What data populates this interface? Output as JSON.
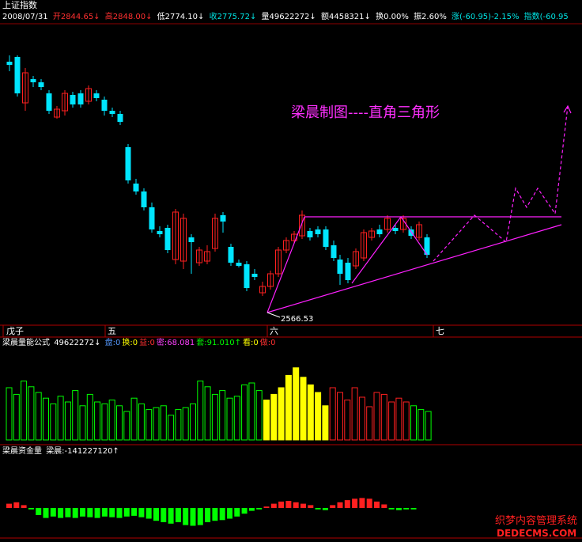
{
  "window": {
    "title": "上证指数"
  },
  "info_bar": {
    "date": "2008/07/31",
    "open": "开2844.65↓",
    "high": "高2848.00↓",
    "low": "低2774.10↓",
    "close": "收2775.72↓",
    "volume": "量49622272↓",
    "amount": "额4458321↓",
    "turnover": "换0.00%",
    "amplitude": "振2.60%",
    "change": "涨(-60.95)-2.15%",
    "index": "指数(-60.95"
  },
  "price_chart": {
    "annotation_title": "梁晨制图----直角三角形",
    "low_label": "2566.53",
    "colors": {
      "up": "#ff2020",
      "down": "#00e5ff",
      "drawing": "#ff20ff"
    }
  },
  "time_axis": {
    "labels": [
      "戊子",
      "五",
      "六",
      "七"
    ]
  },
  "volume_panel": {
    "formula": "梁晨量能公式",
    "value": "49622272↓",
    "items": [
      {
        "text": "盘:0",
        "color": "#5599ff"
      },
      {
        "text": "换:0",
        "color": "#ffff00"
      },
      {
        "text": "益:0",
        "color": "#ff3030"
      },
      {
        "text": "密:68.081",
        "color": "#ff40ff"
      },
      {
        "text": "套:91.010↑",
        "color": "#00ff00"
      },
      {
        "text": "看:0",
        "color": "#ffff00"
      },
      {
        "text": "做:0",
        "color": "#ff3030"
      }
    ],
    "values": [
      55,
      48,
      62,
      56,
      50,
      44,
      38,
      46,
      40,
      52,
      36,
      48,
      40,
      38,
      42,
      36,
      30,
      44,
      38,
      32,
      34,
      36,
      26,
      32,
      34,
      38,
      62,
      56,
      48,
      52,
      44,
      46,
      58,
      60,
      52,
      42,
      48,
      55,
      68,
      76,
      66,
      58,
      50,
      36,
      55,
      50,
      42,
      55,
      45,
      35,
      50,
      48,
      40,
      44,
      40,
      36,
      32,
      30
    ],
    "colors": [
      "green",
      "green",
      "green",
      "green",
      "green",
      "green",
      "green",
      "green",
      "green",
      "green",
      "green",
      "green",
      "green",
      "green",
      "green",
      "green",
      "green",
      "green",
      "green",
      "green",
      "green",
      "green",
      "green",
      "green",
      "green",
      "green",
      "green",
      "green",
      "green",
      "green",
      "green",
      "green",
      "green",
      "green",
      "green",
      "yellow",
      "yellow",
      "yellow",
      "yellow",
      "yellow",
      "yellow",
      "yellow",
      "yellow",
      "yellow",
      "red",
      "red",
      "red",
      "red",
      "red",
      "red",
      "red",
      "red",
      "red",
      "red",
      "red",
      "green",
      "green",
      "green"
    ]
  },
  "fund_panel": {
    "formula": "梁晨资金量",
    "value": "梁晨:-141227120↑",
    "values": [
      6,
      8,
      4,
      -2,
      -10,
      -14,
      -12,
      -14,
      -13,
      -14,
      -12,
      -13,
      -14,
      -12,
      -13,
      -14,
      -12,
      -11,
      -13,
      -15,
      -18,
      -20,
      -22,
      -20,
      -24,
      -25,
      -24,
      -20,
      -18,
      -17,
      -15,
      -12,
      -8,
      -4,
      -2,
      2,
      6,
      9,
      10,
      8,
      6,
      4,
      -2,
      -3,
      4,
      8,
      11,
      13,
      14,
      13,
      9,
      5,
      -2,
      -3,
      -2,
      -2
    ],
    "colors": [
      "red",
      "red",
      "red",
      "green",
      "green",
      "green",
      "green",
      "green",
      "green",
      "green",
      "green",
      "green",
      "green",
      "green",
      "green",
      "green",
      "green",
      "green",
      "green",
      "green",
      "green",
      "green",
      "green",
      "green",
      "green",
      "green",
      "green",
      "green",
      "green",
      "green",
      "green",
      "green",
      "green",
      "green",
      "green",
      "red",
      "red",
      "red",
      "red",
      "red",
      "red",
      "red",
      "green",
      "green",
      "red",
      "red",
      "red",
      "red",
      "red",
      "red",
      "red",
      "red",
      "green",
      "green",
      "green",
      "green"
    ]
  },
  "watermark": {
    "line1": "织梦内容管理系统",
    "line2": "DEDECMS.COM"
  }
}
